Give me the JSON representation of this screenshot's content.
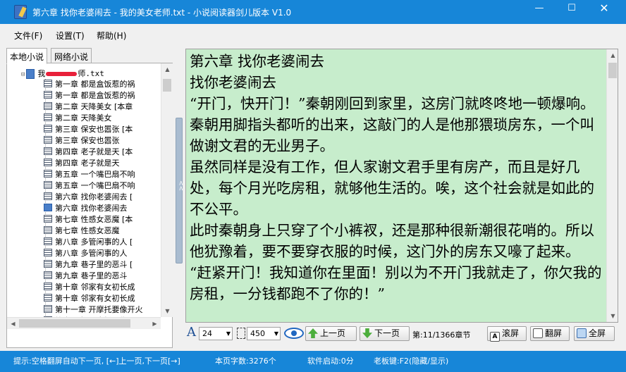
{
  "window": {
    "title": "第六章 找你老婆闹去 - 我的美女老师.txt - 小说阅读器剑儿版本 V1.0",
    "min_glyph": "—",
    "max_glyph": "☐",
    "close_glyph": "✕"
  },
  "menu": {
    "file": "文件(F)",
    "settings": "设置(T)",
    "help": "帮助(H)"
  },
  "tabs": {
    "local": "本地小说",
    "online": "网络小说"
  },
  "tree": {
    "root_prefix": "我",
    "root_suffix": "师.txt",
    "chapters": [
      "第一章 都是盒饭惹的祸",
      "第一章 都是盒饭惹的祸",
      "第二章 天降美女 [本章",
      "第二章 天降美女",
      "第三章 保安也嚣张 [本",
      "第三章 保安也嚣张",
      "第四章 老子就是天 [本",
      "第四章 老子就是天",
      "第五章 一个嘴巴扇不响",
      "第五章 一个嘴巴扇不响",
      "第六章 找你老婆闹去 [",
      "第六章 找你老婆闹去",
      "第七章 性感女恶魔 [本",
      "第七章 性感女恶魔",
      "第八章 多管闲事的人 [",
      "第八章 多管闲事的人",
      "第九章 巷子里的恶斗 [",
      "第九章 巷子里的恶斗",
      "第十章 邻家有女初长成",
      "第十章 邻家有女初长成",
      "第十一章 开摩托要像开火",
      "第十一章 开摩托要像开火"
    ]
  },
  "reader": {
    "paragraphs": [
      "第六章 找你老婆闹去",
      " 找你老婆闹去",
      "“开门，快开门！”秦朝刚回到家里，这房门就咚咚地一顿爆响。秦朝用脚指头都听的出来，这敲门的人是他那猥琐房东，一个叫做谢文君的无业男子。",
      "虽然同样是没有工作，但人家谢文君手里有房产，而且是好几处，每个月光吃房租，就够他生活的。唉，这个社会就是如此的不公平。",
      "此时秦朝身上只穿了个小裤衩，还是那种很新潮很花哨的。所以他犹豫着，要不要穿衣服的时候，这门外的房东又嚎了起来。",
      "“赶紧开门！我知道你在里面！别以为不开门我就走了，你欠我的房租，一分钱都跑不了你的！”"
    ],
    "background_color": "#c7edcc"
  },
  "toolbar": {
    "font_glyph": "A",
    "font_size": "24",
    "line_width": "450",
    "prev_label": "上一页",
    "next_label": "下一页",
    "page_info": "第:11/1366章节",
    "scroll_label": "滚屏",
    "flip_label": "翻屏",
    "fullscreen_label": "全屏"
  },
  "status": {
    "hint": "提示:空格翻屏自动下一页, [←]上一页,下一页[→]",
    "char_count": "本页字数:3276个",
    "startup": "软件启动:0分",
    "boss_key": "老板键:F2(隐藏/显示)"
  },
  "colors": {
    "titlebar": "#1786d8",
    "reader_bg": "#c7edcc",
    "statusbar": "#1786d8"
  }
}
